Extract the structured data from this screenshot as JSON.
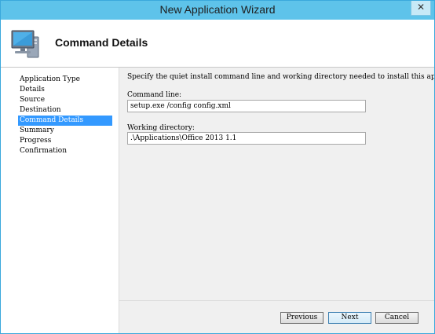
{
  "window": {
    "title": "New Application Wizard",
    "close_glyph": "✕"
  },
  "header": {
    "title": "Command Details",
    "icon": "computer-monitor-icon"
  },
  "sidebar": {
    "items": [
      {
        "label": "Application Type",
        "active": false
      },
      {
        "label": "Details",
        "active": false
      },
      {
        "label": "Source",
        "active": false
      },
      {
        "label": "Destination",
        "active": false
      },
      {
        "label": "Command Details",
        "active": true
      },
      {
        "label": "Summary",
        "active": false
      },
      {
        "label": "Progress",
        "active": false
      },
      {
        "label": "Confirmation",
        "active": false
      }
    ]
  },
  "main": {
    "instruction": "Specify the quiet install command line and working directory needed to install this ap",
    "command_line": {
      "label": "Command line:",
      "value": "setup.exe /config config.xml"
    },
    "working_directory": {
      "label": "Working directory:",
      "value": ".\\Applications\\Office 2013 1.1"
    }
  },
  "footer": {
    "previous_label": "Previous",
    "next_label": "Next",
    "cancel_label": "Cancel"
  },
  "colors": {
    "titlebar": "#5ec3ea",
    "selection": "#3399ff",
    "panel": "#f0f0f0"
  }
}
